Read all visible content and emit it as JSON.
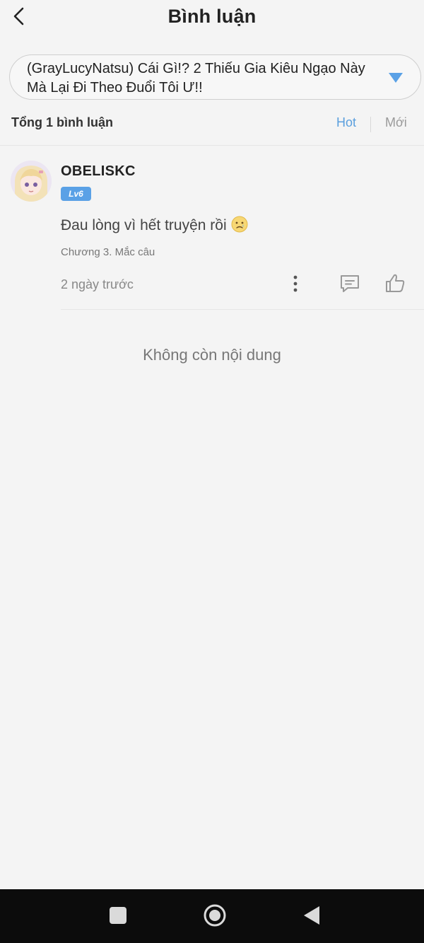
{
  "header": {
    "title": "Bình luận"
  },
  "story_selector": {
    "title": "(GrayLucyNatsu) Cái Gì!? 2 Thiếu Gia Kiêu Ngạo Này Mà Lại Đi Theo Đuổi Tôi Ư!!",
    "arrow_color": "#5aa1e6"
  },
  "summary": {
    "count_text": "Tổng 1 bình luận",
    "sort_hot": "Hot",
    "sort_new": "Mới",
    "active_color": "#5a9fde"
  },
  "comments": [
    {
      "username": "OBELISKC",
      "level": "Lv6",
      "text": "Đau lòng vì hết truyện rồi",
      "emoji": "sad-face-icon",
      "chapter": "Chương 3. Mắc câu",
      "time": "2 ngày trước"
    }
  ],
  "empty_state": "Không còn nội dung",
  "icons": {
    "back": "chevron-left-icon",
    "dropdown": "triangle-down-icon",
    "more": "more-vertical-icon",
    "reply": "comment-icon",
    "like": "thumbs-up-icon",
    "nav_recent": "square-icon",
    "nav_home": "circle-icon",
    "nav_back": "triangle-left-icon"
  }
}
